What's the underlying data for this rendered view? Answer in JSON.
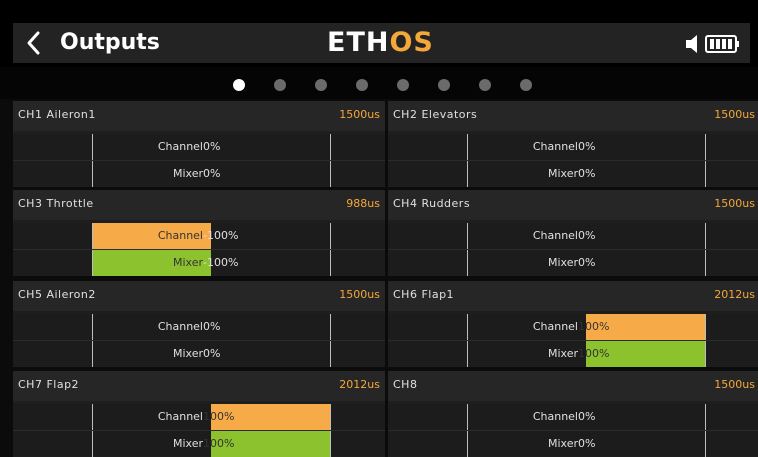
{
  "header": {
    "title": "Outputs",
    "logo_main": "ETH",
    "logo_accent": "OS",
    "accent_color": "#f5a83a"
  },
  "pager": {
    "pages": 8,
    "active": 1
  },
  "labels": {
    "channel": "Channel",
    "mixer": "Mixer"
  },
  "colors": {
    "channel_bar": "#f6ab48",
    "mixer_bar": "#8dc22f",
    "value": "#f5a83a"
  },
  "outputs": [
    {
      "name": "CH1 Aileron1",
      "pulse": "1500us",
      "channel": "0%",
      "mixer": "0%",
      "channel_pct": 0,
      "mixer_pct": 0
    },
    {
      "name": "CH2 Elevators",
      "pulse": "1500us",
      "channel": "0%",
      "mixer": "0%",
      "channel_pct": 0,
      "mixer_pct": 0
    },
    {
      "name": "CH3 Throttle",
      "pulse": "988us",
      "channel": "-100%",
      "mixer": "-100%",
      "channel_pct": -100,
      "mixer_pct": -100
    },
    {
      "name": "CH4 Rudders",
      "pulse": "1500us",
      "channel": "0%",
      "mixer": "0%",
      "channel_pct": 0,
      "mixer_pct": 0
    },
    {
      "name": "CH5 Aileron2",
      "pulse": "1500us",
      "channel": "0%",
      "mixer": "0%",
      "channel_pct": 0,
      "mixer_pct": 0
    },
    {
      "name": "CH6 Flap1",
      "pulse": "2012us",
      "channel": "100%",
      "mixer": "100%",
      "channel_pct": 100,
      "mixer_pct": 100
    },
    {
      "name": "CH7 Flap2",
      "pulse": "2012us",
      "channel": "100%",
      "mixer": "100%",
      "channel_pct": 100,
      "mixer_pct": 100
    },
    {
      "name": "CH8",
      "pulse": "1500us",
      "channel": "0%",
      "mixer": "0%",
      "channel_pct": 0,
      "mixer_pct": 0
    }
  ]
}
